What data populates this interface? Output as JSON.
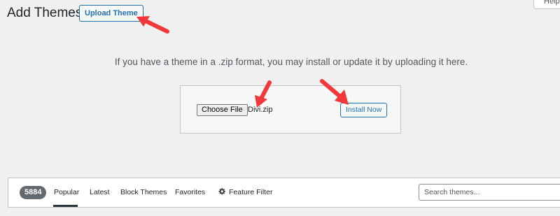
{
  "header": {
    "title": "Add Themes",
    "upload_button": "Upload Theme",
    "help_tab": "Help"
  },
  "upload": {
    "description": "If you have a theme in a .zip format, you may install or update it by uploading it here.",
    "choose_file_label": "Choose File",
    "file_name": "Divi.zip",
    "install_button": "Install Now"
  },
  "filter_bar": {
    "count": "5884",
    "tabs": [
      {
        "label": "Popular",
        "current": true
      },
      {
        "label": "Latest",
        "current": false
      },
      {
        "label": "Block Themes",
        "current": false
      },
      {
        "label": "Favorites",
        "current": false
      }
    ],
    "feature_filter": {
      "label": "Feature Filter",
      "icon": "gear-icon"
    },
    "search": {
      "placeholder": "Search themes...",
      "value": ""
    }
  },
  "annotations": {
    "arrow_color": "#f2383a",
    "arrow_count": 3
  },
  "colors": {
    "accent": "#2271b1",
    "background": "#f0f0f1",
    "badge": "#646970"
  }
}
